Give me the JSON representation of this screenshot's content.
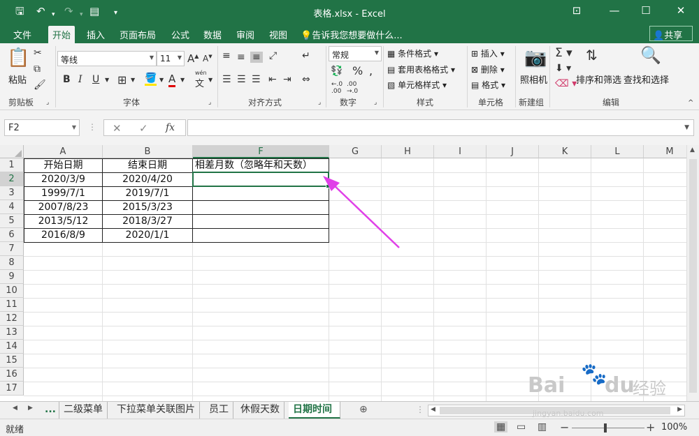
{
  "window": {
    "title": "表格.xlsx - Excel",
    "quick_access": [
      "save-icon",
      "undo-icon",
      "redo-icon",
      "form-icon",
      "customize-icon"
    ],
    "controls": [
      "ribbon-display-icon",
      "minimize-icon",
      "maximize-icon",
      "close-icon"
    ]
  },
  "ribbon": {
    "tabs": [
      {
        "label": "文件"
      },
      {
        "label": "开始",
        "active": true
      },
      {
        "label": "插入"
      },
      {
        "label": "页面布局"
      },
      {
        "label": "公式"
      },
      {
        "label": "数据"
      },
      {
        "label": "审阅"
      },
      {
        "label": "视图"
      }
    ],
    "tell_me": "告诉我您想要做什么...",
    "share": "共享",
    "groups": {
      "clipboard": {
        "label": "剪贴板",
        "paste": "粘贴"
      },
      "font": {
        "label": "字体",
        "font_name": "等线",
        "font_size": "11",
        "wen": "wén",
        "wen_char": "文"
      },
      "alignment": {
        "label": "对齐方式"
      },
      "number": {
        "label": "数字",
        "format": "常规"
      },
      "styles": {
        "label": "样式",
        "conditional": "条件格式",
        "table": "套用表格格式",
        "cell": "单元格样式"
      },
      "cells": {
        "label": "单元格",
        "insert": "插入",
        "delete": "删除",
        "format": "格式"
      },
      "new_group": {
        "label": "新建组",
        "camera": "照相机"
      },
      "editing": {
        "label": "编辑",
        "sort": "排序和筛选",
        "find": "查找和选择"
      }
    }
  },
  "formula_bar": {
    "name_box": "F2",
    "fx": "fx",
    "value": ""
  },
  "sheet": {
    "columns": [
      "A",
      "B",
      "F",
      "G",
      "H",
      "I",
      "J",
      "K",
      "L",
      "M"
    ],
    "selected_column": "F",
    "rows": [
      "1",
      "2",
      "3",
      "4",
      "5",
      "6",
      "7",
      "8",
      "9",
      "10",
      "11",
      "12",
      "13",
      "14",
      "15",
      "16",
      "17"
    ],
    "selected_row": "2",
    "headers": {
      "a": "开始日期",
      "b": "结束日期",
      "f": "相差月数（忽略年和天数）"
    },
    "data": [
      {
        "a": "2020/3/9",
        "b": "2020/4/20",
        "f": ""
      },
      {
        "a": "1999/7/1",
        "b": "2019/7/1",
        "f": ""
      },
      {
        "a": "2007/8/23",
        "b": "2015/3/23",
        "f": ""
      },
      {
        "a": "2013/5/12",
        "b": "2018/3/27",
        "f": ""
      },
      {
        "a": "2016/8/9",
        "b": "2020/1/1",
        "f": ""
      }
    ]
  },
  "sheet_tabs": {
    "ellipsis": "...",
    "tabs": [
      {
        "label": "二级菜单"
      },
      {
        "label": "下拉菜单关联图片"
      },
      {
        "label": "员工"
      },
      {
        "label": "休假天数"
      },
      {
        "label": "日期时间",
        "active": true
      }
    ]
  },
  "status": {
    "ready": "就绪",
    "zoom": "100%"
  },
  "watermark": {
    "brand": "Bai",
    "brand2": "du",
    "cn": "经验",
    "url": "jingyan.baidu.com"
  },
  "colors": {
    "excel_green": "#217346",
    "arrow": "#e040e8"
  }
}
